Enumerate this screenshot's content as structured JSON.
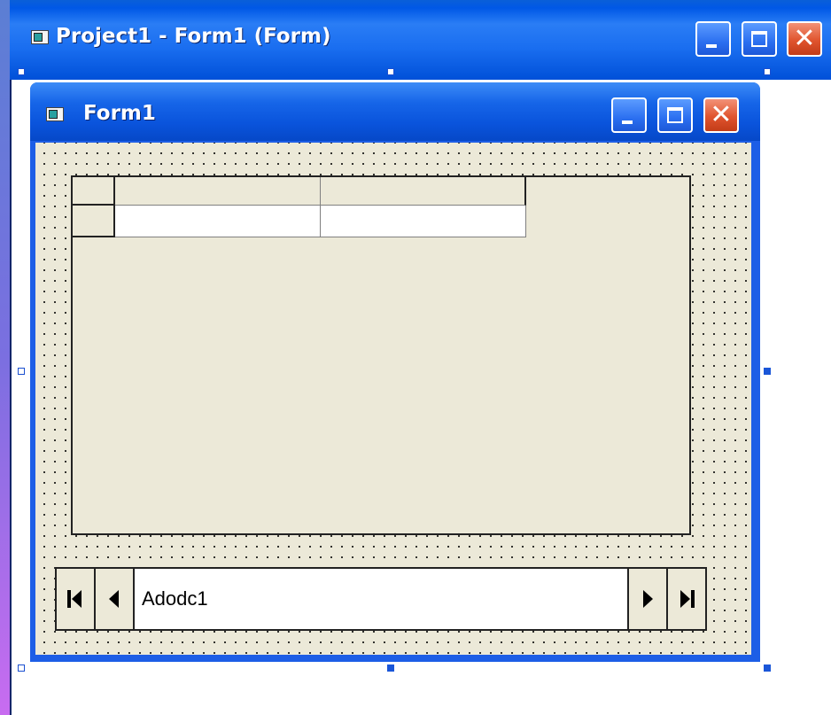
{
  "outer_window": {
    "title": "Project1 - Form1 (Form)",
    "icon": "form-icon",
    "buttons": [
      "minimize",
      "maximize",
      "close"
    ]
  },
  "form_window": {
    "title": "Form1",
    "icon": "form-icon",
    "buttons": [
      "minimize",
      "maximize",
      "close"
    ]
  },
  "data_grid": {
    "rows": 2,
    "columns": 3
  },
  "adodc": {
    "caption": "Adodc1",
    "buttons": [
      "move-first",
      "move-previous",
      "move-next",
      "move-last"
    ]
  },
  "colors": {
    "titlebar_blue": "#0058e6",
    "close_red": "#e0542e",
    "form_background": "#ece9d8"
  }
}
